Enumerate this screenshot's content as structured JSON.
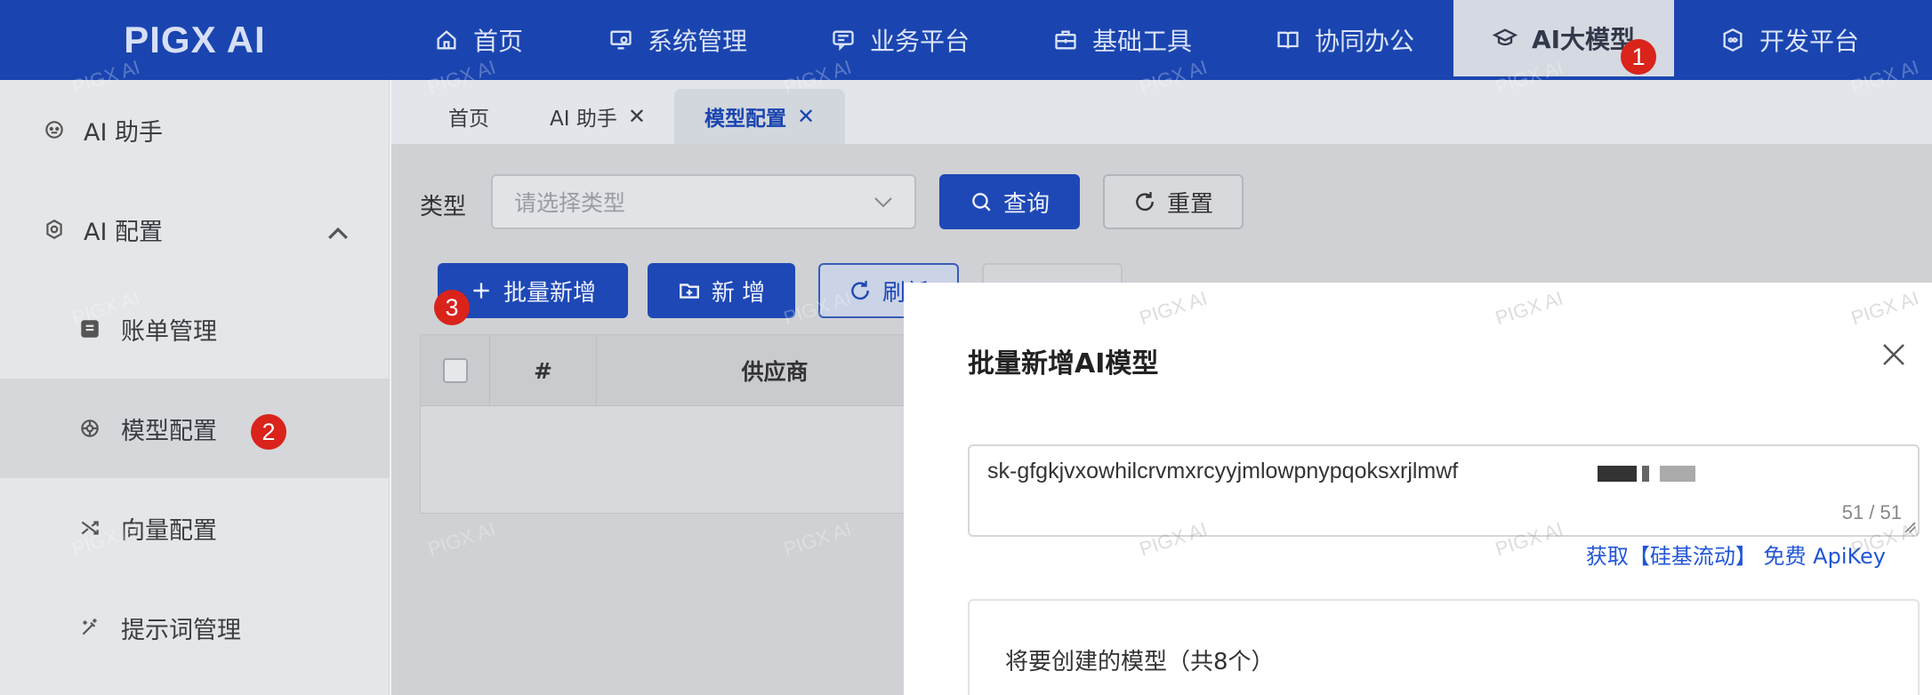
{
  "app": {
    "logo": "PIGX AI"
  },
  "topnav": [
    {
      "label": "首页",
      "icon": "home-icon"
    },
    {
      "label": "系统管理",
      "icon": "monitor-settings-icon"
    },
    {
      "label": "业务平台",
      "icon": "chat-board-icon"
    },
    {
      "label": "基础工具",
      "icon": "toolbox-icon"
    },
    {
      "label": "协同办公",
      "icon": "book-icon"
    },
    {
      "label": "AI大模型",
      "icon": "graduation-cap-icon",
      "active": true
    },
    {
      "label": "开发平台",
      "icon": "infinity-badge-icon"
    }
  ],
  "sidebar": {
    "items": [
      {
        "label": "AI 助手",
        "icon": "robot-face-icon"
      },
      {
        "label": "AI 配置",
        "icon": "ai-gear-icon",
        "expanded": true
      },
      {
        "label": "账单管理",
        "icon": "bill-icon"
      },
      {
        "label": "模型配置",
        "icon": "model-brain-icon",
        "selected": true
      },
      {
        "label": "向量配置",
        "icon": "shuffle-icon"
      },
      {
        "label": "提示词管理",
        "icon": "magic-wand-icon"
      }
    ]
  },
  "tabs": [
    {
      "label": "首页"
    },
    {
      "label": "AI 助手",
      "closable": true
    },
    {
      "label": "模型配置",
      "closable": true,
      "active": true
    }
  ],
  "filter": {
    "type_label": "类型",
    "type_placeholder": "请选择类型",
    "query_label": "查询",
    "reset_label": "重置"
  },
  "toolbar": {
    "batch_add_label": "批量新增",
    "add_label": "新 增",
    "refresh_label": "刷新"
  },
  "table": {
    "columns": [
      "#",
      "供应商"
    ]
  },
  "modal": {
    "title": "批量新增AI模型",
    "api_key_value": "sk-gfgkjvxowhilcrvmxrcyyjmlowpnypqoksxrjlmwf",
    "char_count": "51 / 51",
    "link_text": "获取【硅基流动】 免费 ApiKey",
    "preview_title": "将要创建的模型（共8个）"
  },
  "badges": [
    "1",
    "2",
    "3"
  ],
  "watermark": "PIGX AI",
  "colors": {
    "primary": "#1a45b0",
    "badge": "#d9231b",
    "link": "#2056d6"
  }
}
